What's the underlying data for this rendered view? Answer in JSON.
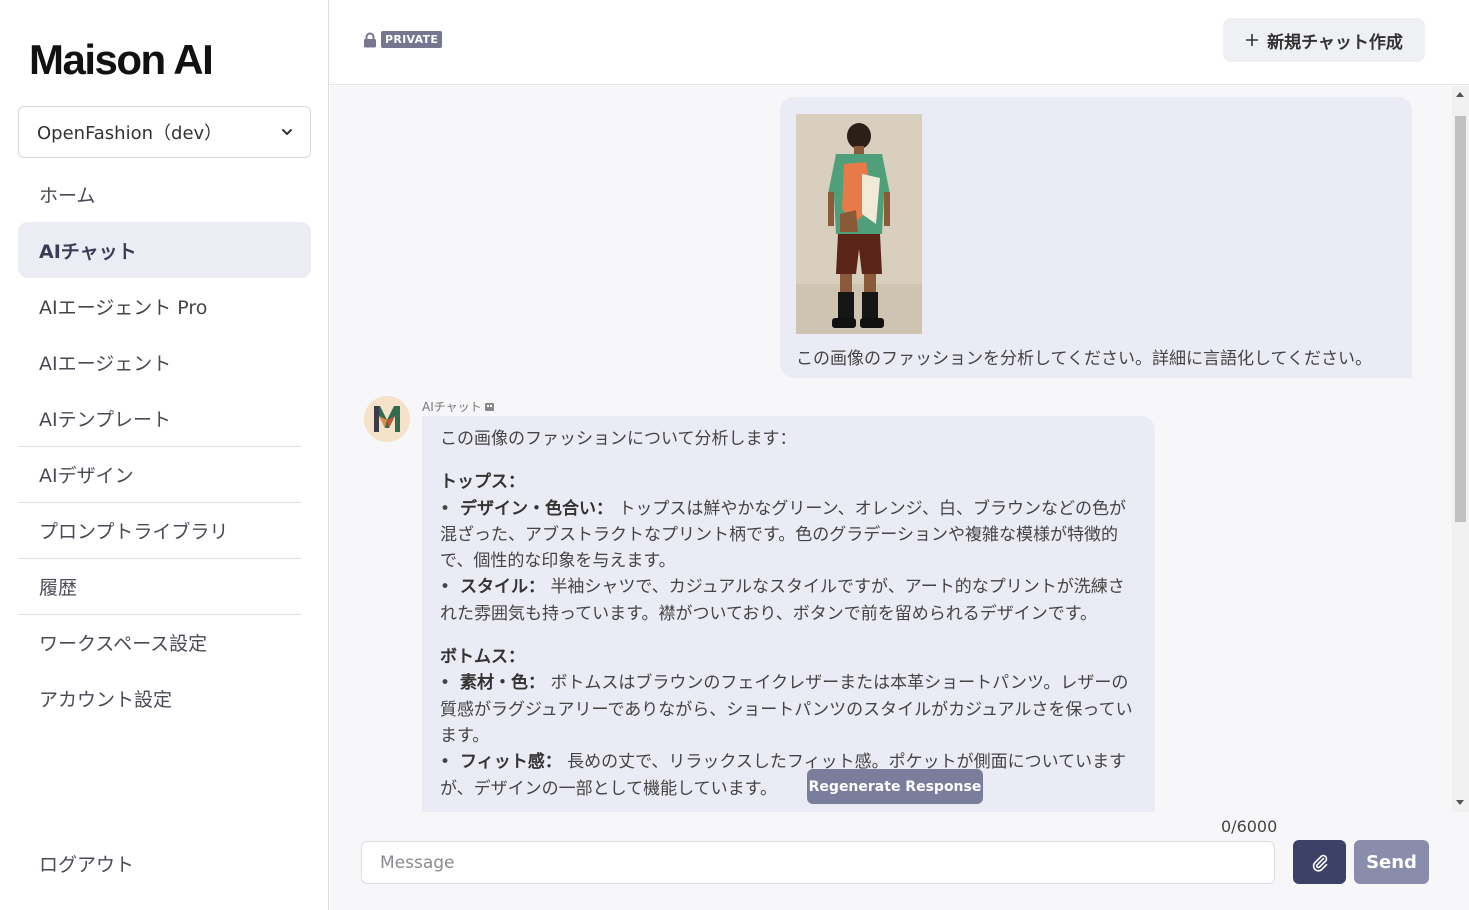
{
  "sidebar": {
    "brand": "Maison AI",
    "workspace": "OpenFashion（dev）",
    "items": [
      {
        "label": "ホーム"
      },
      {
        "label": "AIチャット",
        "active": true
      },
      {
        "label": "AIエージェント Pro"
      },
      {
        "label": "AIエージェント"
      },
      {
        "label": "AIテンプレート"
      },
      {
        "label": "AIデザイン"
      },
      {
        "label": "プロンプトライブラリ"
      },
      {
        "label": "履歴"
      },
      {
        "label": "ワークスペース設定"
      },
      {
        "label": "アカウント設定"
      }
    ],
    "logout": "ログアウト"
  },
  "header": {
    "private_badge": "PRIVATE",
    "new_chat_label": "新規チャット作成"
  },
  "chat": {
    "user_message": "この画像のファッションを分析してください。詳細に言語化してください。",
    "ai_name": "AIチャット",
    "ai_intro": "この画像のファッションについて分析します：",
    "sections": [
      {
        "heading": "トップス：",
        "bullets": [
          {
            "term": "デザイン・色合い：",
            "text": "トップスは鮮やかなグリーン、オレンジ、白、ブラウンなどの色が混ざった、アブストラクトなプリント柄です。色のグラデーションや複雑な模様が特徴的で、個性的な印象を与えます。"
          },
          {
            "term": "スタイル：",
            "text": "半袖シャツで、カジュアルなスタイルですが、アート的なプリントが洗練された雰囲気も持っています。襟がついており、ボタンで前を留められるデザインです。"
          }
        ]
      },
      {
        "heading": "ボトムス：",
        "bullets": [
          {
            "term": "素材・色：",
            "text": "ボトムスはブラウンのフェイクレザーまたは本革ショートパンツ。レザーの質感がラグジュアリーでありながら、ショートパンツのスタイルがカジュアルさを保っています。"
          },
          {
            "term": "フィット感：",
            "text": "長めの丈で、リラックスしたフィット感。ポケットが側面についていますが、デザインの一部として機能しています。"
          }
        ]
      }
    ],
    "regenerate_label": "Regenerate Response"
  },
  "composer": {
    "counter": "0/6000",
    "placeholder": "Message",
    "value": "",
    "send_label": "Send"
  }
}
